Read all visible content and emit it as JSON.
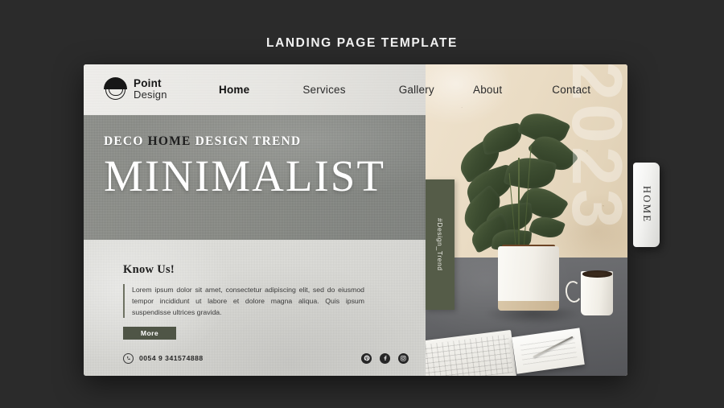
{
  "window": {
    "title": "LANDING PAGE TEMPLATE",
    "background_color": "#2b2b2b"
  },
  "brand": {
    "logo_icon": "point-design-logo-icon",
    "name_line1": "Point",
    "name_line2": "Design"
  },
  "nav": {
    "left_items": [
      {
        "label": "Home",
        "active": true
      },
      {
        "label": "Services",
        "active": false
      },
      {
        "label": "Gallery",
        "active": false
      }
    ],
    "right_items": [
      {
        "label": "About",
        "active": false
      },
      {
        "label": "Contact",
        "active": false
      }
    ]
  },
  "hero": {
    "kicker_part1": "DECO ",
    "kicker_highlight": "HOME",
    "kicker_part2": " DESIGN TREND",
    "title": "MINIMALIST",
    "band_color": "#8a8c87"
  },
  "hashtag_strip": {
    "text": "#Design_Trend",
    "color": "#555c48"
  },
  "about": {
    "heading": "Know Us!",
    "body": "Lorem ipsum dolor sit amet, consectetur adipiscing elit, sed do eiusmod tempor incididunt ut labore et dolore magna aliqua. Quis ipsum suspendisse ultrices gravida.",
    "button_label": "More",
    "button_color": "#4f5546",
    "accent_bar_color": "#6e7262"
  },
  "footer": {
    "phone_icon": "whatsapp-icon",
    "phone": "0054 9 341574888",
    "socials": [
      {
        "name": "pinterest-icon",
        "glyph": "P"
      },
      {
        "name": "facebook-icon",
        "glyph": "f"
      },
      {
        "name": "instagram-icon",
        "glyph": "◎"
      }
    ]
  },
  "photo": {
    "watermark_year": "2023",
    "alt": "potted plant on gray desk with keyboard, notepad, pen and white coffee mug against beige textured wall"
  },
  "side_tab": {
    "label": "HOME"
  }
}
